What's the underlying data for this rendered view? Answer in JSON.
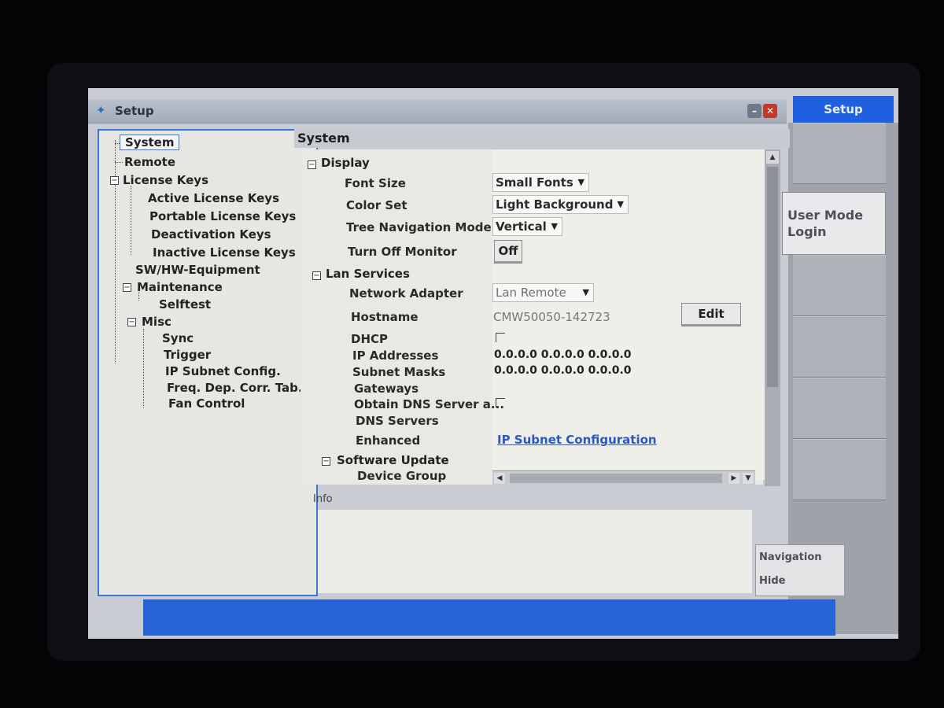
{
  "window": {
    "title": "Setup"
  },
  "tree": {
    "items": [
      {
        "label": "System"
      },
      {
        "label": "Remote"
      },
      {
        "label": "License Keys"
      },
      {
        "label": "Active License Keys"
      },
      {
        "label": "Portable License Keys"
      },
      {
        "label": "Deactivation Keys"
      },
      {
        "label": "Inactive License Keys"
      },
      {
        "label": "SW/HW-Equipment"
      },
      {
        "label": "Maintenance"
      },
      {
        "label": "Selftest"
      },
      {
        "label": "Misc"
      },
      {
        "label": "Sync"
      },
      {
        "label": "Trigger"
      },
      {
        "label": "IP Subnet Config."
      },
      {
        "label": "Freq. Dep. Corr. Tab..."
      },
      {
        "label": "Fan Control"
      }
    ]
  },
  "panel": {
    "title": "System",
    "display": {
      "section": "Display",
      "font_size_label": "Font Size",
      "font_size_value": "Small Fonts",
      "color_set_label": "Color Set",
      "color_set_value": "Light Background",
      "tree_nav_label": "Tree Navigation Mode",
      "tree_nav_value": "Vertical",
      "monitor_label": "Turn Off Monitor",
      "monitor_button": "Off"
    },
    "lan": {
      "section": "Lan Services",
      "adapter_label": "Network Adapter",
      "adapter_value": "Lan Remote",
      "hostname_label": "Hostname",
      "hostname_value": "CMW50050-142723",
      "edit_button": "Edit",
      "dhcp_label": "DHCP",
      "ip_label": "IP Addresses",
      "ip_value": "0.0.0.0 0.0.0.0 0.0.0.0",
      "subnet_label": "Subnet Masks",
      "subnet_value": "0.0.0.0 0.0.0.0 0.0.0.0",
      "gateways_label": "Gateways",
      "obtain_dns_label": "Obtain DNS Server a...",
      "dns_label": "DNS Servers",
      "enhanced_label": "Enhanced",
      "enhanced_link": "IP Subnet Configuration"
    },
    "software_update": {
      "section": "Software Update",
      "device_group_label": "Device Group"
    }
  },
  "info": {
    "label": "Info"
  },
  "side": {
    "header": "Setup",
    "user_mode": "User Mode\nLogin",
    "navigation": "Navigation",
    "hide": "Hide"
  }
}
